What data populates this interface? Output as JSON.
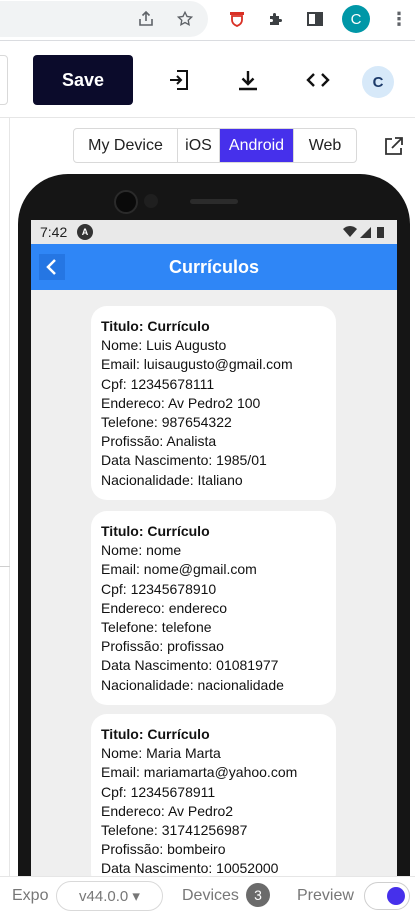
{
  "browser": {
    "profile_initial": "C",
    "extension_badge": "C"
  },
  "toolbar": {
    "save_label": "Save",
    "user_initial": "C"
  },
  "platforms": {
    "selected": "Android",
    "options": [
      "My Device",
      "iOS",
      "Android",
      "Web"
    ]
  },
  "device": {
    "status_time": "7:42",
    "status_badge": "A",
    "app_title": "Currículos"
  },
  "curriculos": [
    {
      "titulo": "Titulo: Currículo",
      "nome": "Nome: Luis Augusto",
      "email": "Email: luisaugusto@gmail.com",
      "cpf": "Cpf: 12345678111",
      "endereco": "Endereco: Av Pedro2 100",
      "telefone": "Telefone: 987654322",
      "profissao": "Profissão: Analista",
      "nascimento": "Data Nascimento: 1985/01",
      "nacionalidade": "Nacionalidade: Italiano"
    },
    {
      "titulo": "Titulo: Currículo",
      "nome": "Nome: nome",
      "email": "Email: nome@gmail.com",
      "cpf": "Cpf: 12345678910",
      "endereco": "Endereco: endereco",
      "telefone": "Telefone: telefone",
      "profissao": "Profissão: profissao",
      "nascimento": "Data Nascimento: 01081977",
      "nacionalidade": "Nacionalidade: nacionalidade"
    },
    {
      "titulo": "Titulo: Currículo",
      "nome": "Nome: Maria Marta",
      "email": "Email: mariamarta@yahoo.com",
      "cpf": "Cpf: 12345678911",
      "endereco": "Endereco: Av Pedro2",
      "telefone": "Telefone: 31741256987",
      "profissao": "Profissão: bombeiro",
      "nascimento": "Data Nascimento: 10052000",
      "nacionalidade": ""
    }
  ],
  "bottom": {
    "expo_label": "Expo",
    "version": "v44.0.0 ▾",
    "devices_label": "Devices",
    "devices_count": "3",
    "preview_label": "Preview",
    "preview_on": true
  },
  "colors": {
    "save_bg": "#0b0b2b",
    "platform_active": "#4630eb",
    "appbar": "#2f86f6",
    "toggle_on": "#4630eb"
  }
}
